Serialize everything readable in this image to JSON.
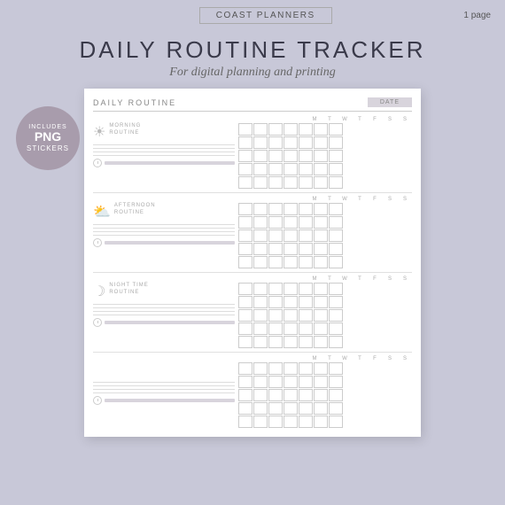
{
  "topbar": {
    "brand": "COAST PLANNERS",
    "pages": "1 page"
  },
  "hero": {
    "title": "DAILY ROUTINE TRACKER",
    "subtitle": "For digital planning and printing"
  },
  "badge": {
    "includes": "INCLUDES",
    "png": "PNG",
    "stickers": "STICKERS"
  },
  "planner": {
    "title": "DAILY ROUTINE",
    "date_label": "DATE",
    "days": [
      "M",
      "T",
      "W",
      "T",
      "F",
      "S",
      "S"
    ],
    "sections": [
      {
        "name": "MORNING\nROUTINE",
        "icon": "☀",
        "lines": 4
      },
      {
        "name": "AFTERNOON\nROUTINE",
        "icon": "⛅",
        "lines": 4
      },
      {
        "name": "NIGHT TIME\nROUTINE",
        "icon": "☽",
        "lines": 4
      },
      {
        "name": "",
        "icon": "",
        "lines": 4
      }
    ]
  }
}
